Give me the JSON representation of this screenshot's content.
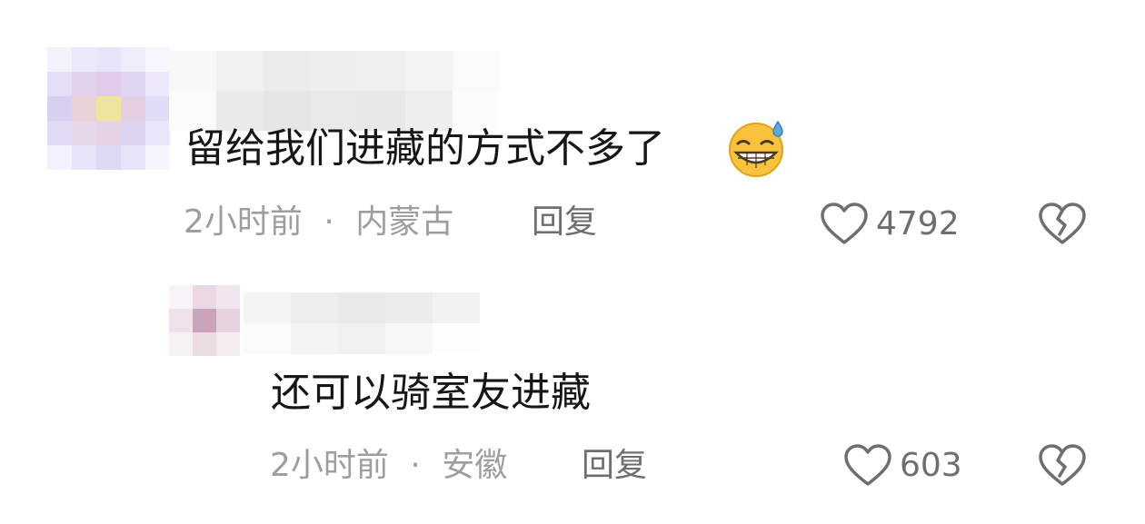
{
  "comments": [
    {
      "text": "留给我们进藏的方式不多了",
      "emoji": "sweat-grin-emoji",
      "time": "2小时前",
      "separator": "·",
      "location": "内蒙古",
      "reply_label": "回复",
      "likes": "4792"
    },
    {
      "text": "还可以骑室友进藏",
      "time": "2小时前",
      "separator": "·",
      "location": "安徽",
      "reply_label": "回复",
      "likes": "603"
    }
  ],
  "colors": {
    "text": "#161616",
    "meta": "#9e9e9e",
    "action": "#6e6e6e",
    "emoji_face": "#f9c23c",
    "emoji_drop": "#5aa9e6"
  },
  "icons": [
    "heart-outline-icon",
    "broken-heart-icon"
  ]
}
